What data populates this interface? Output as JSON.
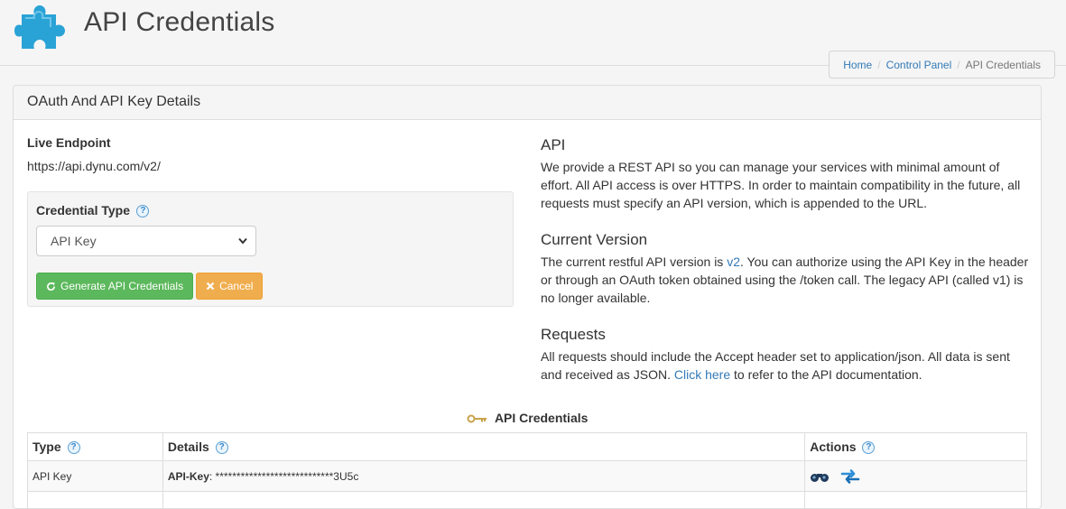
{
  "header": {
    "title": "API Credentials"
  },
  "breadcrumb": {
    "items": [
      "Home",
      "Control Panel",
      "API Credentials"
    ]
  },
  "panel": {
    "heading": "OAuth And API Key Details"
  },
  "endpoint": {
    "label": "Live Endpoint",
    "url": "https://api.dynu.com/v2/"
  },
  "credential_form": {
    "label": "Credential Type",
    "selected": "API Key",
    "generate_label": "Generate API Credentials",
    "cancel_label": "Cancel"
  },
  "info": {
    "api_title": "API",
    "api_text": "We provide a REST API so you can manage your services with minimal amount of effort. All API access is over HTTPS. In order to maintain compatibility in the future, all requests must specify an API version, which is appended to the URL.",
    "version_title": "Current Version",
    "version_text_before": "The current restful API version is ",
    "version_link": "v2",
    "version_text_after": ". You can authorize using the API Key in the header or through an OAuth token obtained using the /token call. The legacy API (called v1) is no longer available.",
    "requests_title": "Requests",
    "requests_text_before": "All requests should include the Accept header set to application/json. All data is sent and received as JSON. ",
    "requests_link": "Click here",
    "requests_text_after": " to refer to the API documentation."
  },
  "credentials_table": {
    "title": "API Credentials",
    "headers": {
      "type": "Type",
      "details": "Details",
      "actions": "Actions"
    },
    "rows": [
      {
        "type": "API Key",
        "details_label": "API-Key",
        "details_value": ": ****************************3U5c"
      }
    ]
  },
  "colors": {
    "success": "#5cb85c",
    "warning": "#f0ad4e",
    "link": "#337ab7",
    "logo": "#29a3d6"
  },
  "icons": [
    "puzzle-logo",
    "help-icon",
    "refresh-icon",
    "close-icon",
    "key-icon",
    "binoculars-icon",
    "swap-icon"
  ]
}
